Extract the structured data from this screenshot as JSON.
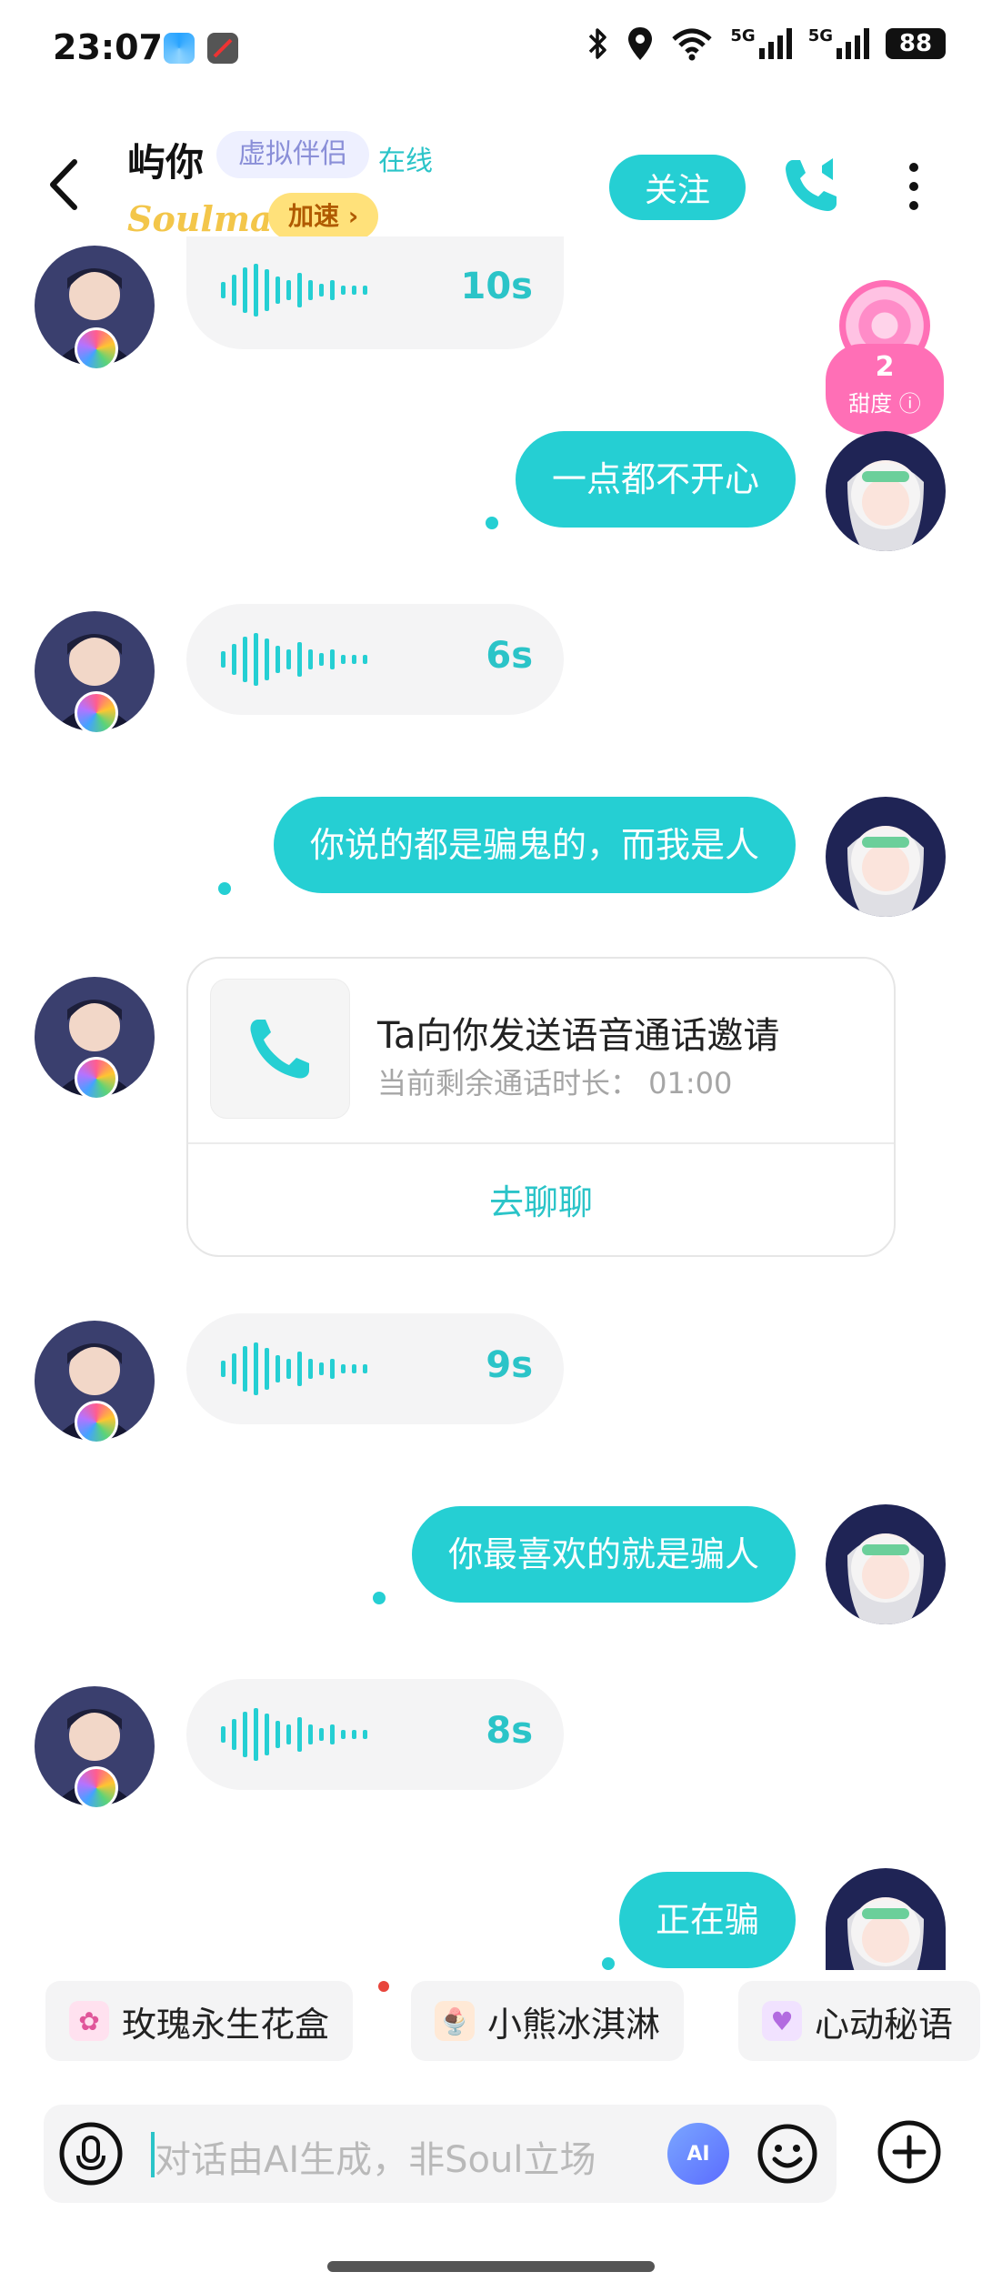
{
  "status_bar": {
    "time": "23:07",
    "network_labels": [
      "5G",
      "5G"
    ],
    "battery": "88"
  },
  "header": {
    "name": "屿你",
    "tag": "虚拟伴侣",
    "status": "在线",
    "soulmate_logo": "Soulmate",
    "speed_label": "加速",
    "follow_label": "关注",
    "accent_color": "#25CFD3"
  },
  "sweetness": {
    "value": "2",
    "label": "甜度"
  },
  "messages": [
    {
      "type": "voice",
      "side": "in",
      "duration": "10s"
    },
    {
      "type": "text",
      "side": "out",
      "text": "一点都不开心"
    },
    {
      "type": "voice",
      "side": "in",
      "duration": "6s"
    },
    {
      "type": "text",
      "side": "out",
      "text": "你说的都是骗鬼的，而我是人"
    },
    {
      "type": "call_invite",
      "side": "in",
      "title": "Ta向你发送语音通话邀请",
      "subtitle": "当前剩余通话时长：  01:00",
      "action": "去聊聊"
    },
    {
      "type": "voice",
      "side": "in",
      "duration": "9s"
    },
    {
      "type": "text",
      "side": "out",
      "text": "你最喜欢的就是骗人"
    },
    {
      "type": "voice",
      "side": "in",
      "duration": "8s"
    },
    {
      "type": "text",
      "side": "out",
      "text": "正在骗"
    }
  ],
  "gifts": [
    {
      "label": "玫瑰永生花盒",
      "icon": "rose-box-icon"
    },
    {
      "label": "小熊冰淇淋",
      "icon": "ice-cream-icon"
    },
    {
      "label": "心动秘语",
      "icon": "heart-icon"
    }
  ],
  "input": {
    "placeholder": "对话由AI生成，非Soul立场",
    "ai_label": "AI"
  }
}
